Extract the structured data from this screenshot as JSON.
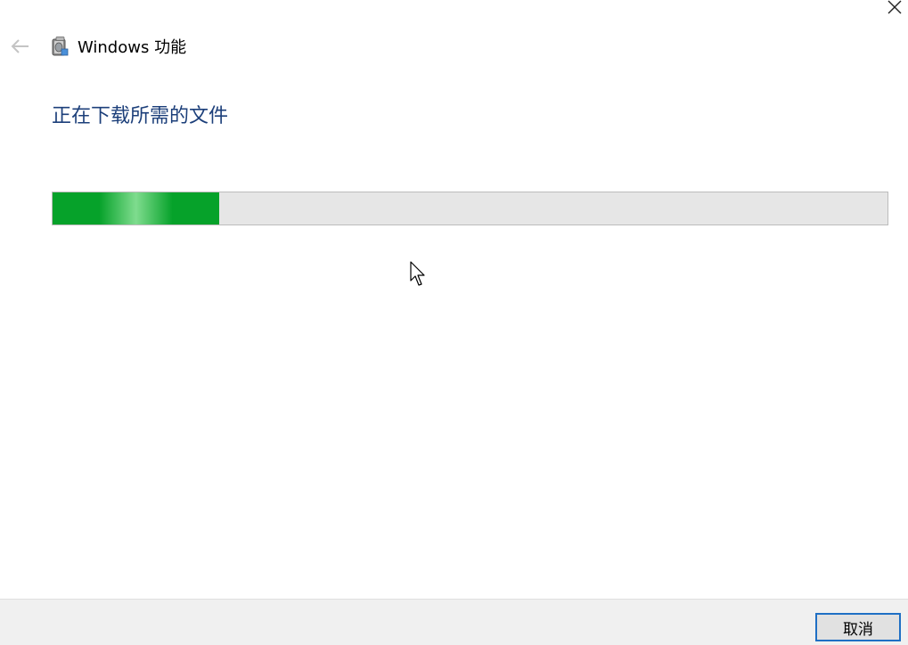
{
  "window": {
    "title": "Windows 功能",
    "close_icon": "close-icon",
    "back_icon": "back-arrow-icon",
    "app_icon": "windows-features-icon"
  },
  "main": {
    "heading": "正在下载所需的文件",
    "progress": {
      "fraction": 0.2,
      "fill_color": "#06a22a",
      "track_color": "#e6e6e6"
    }
  },
  "footer": {
    "cancel_label": "取消"
  },
  "colors": {
    "heading": "#1c3f7a",
    "button_border": "#1f6fc4"
  }
}
